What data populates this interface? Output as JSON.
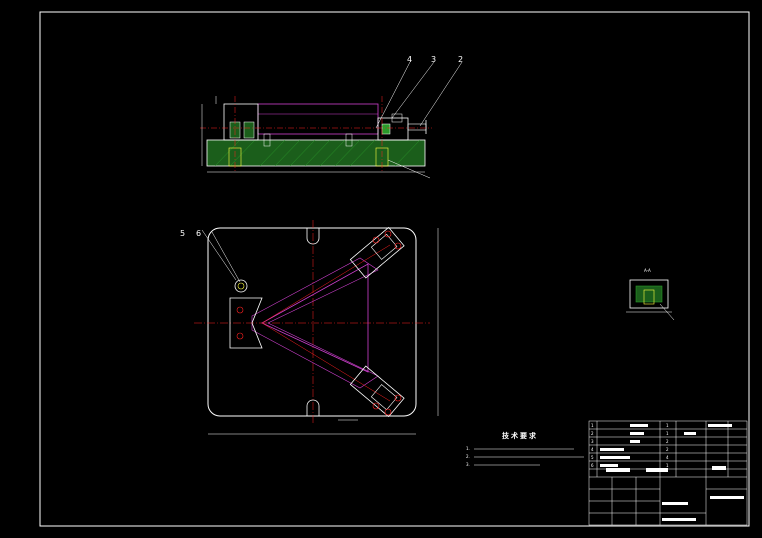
{
  "drawing": {
    "colors": {
      "background": "#000000",
      "frame": "#ffffff",
      "part": "#ffffff",
      "centerline": "#ff2020",
      "link": "#d040d0",
      "hatch": "#2a9a2a",
      "dimension": "#ffffff",
      "section_line": "#ffff40"
    },
    "callouts": {
      "c2": "2",
      "c3": "3",
      "c4": "4",
      "c5": "5",
      "c6": "6"
    },
    "section_label": "A-A",
    "notes_title": "技术要求",
    "notes": [
      "1.",
      "2.",
      "3."
    ],
    "title_block": {
      "rows": [
        {
          "no": "1",
          "qty": "1"
        },
        {
          "no": "2",
          "qty": "1"
        },
        {
          "no": "3",
          "qty": "2"
        },
        {
          "no": "4",
          "qty": "2"
        },
        {
          "no": "5",
          "qty": "4"
        },
        {
          "no": "6",
          "qty": "1"
        }
      ]
    }
  }
}
